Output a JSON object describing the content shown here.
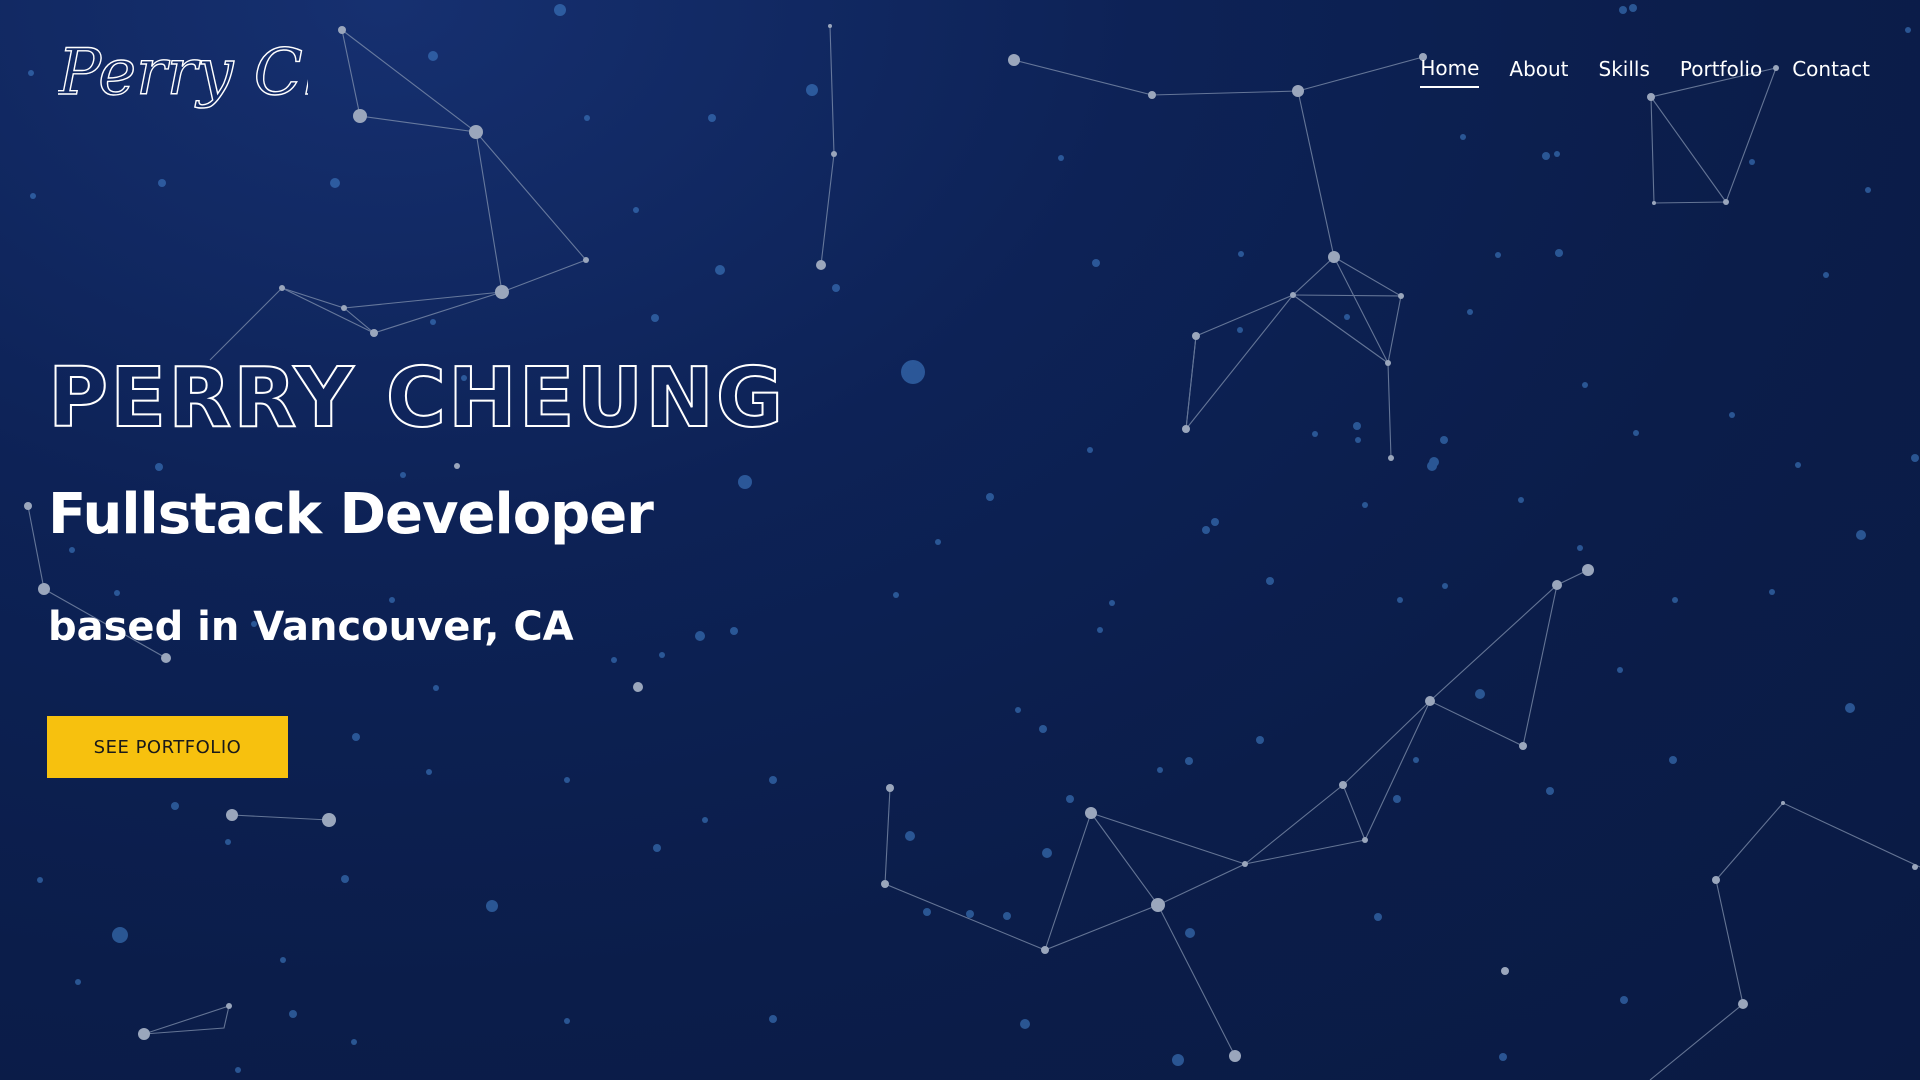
{
  "brand": {
    "logo_text": "Perry Cheung"
  },
  "nav": {
    "items": [
      {
        "label": "Home",
        "active": true
      },
      {
        "label": "About",
        "active": false
      },
      {
        "label": "Skills",
        "active": false
      },
      {
        "label": "Portfolio",
        "active": false
      },
      {
        "label": "Contact",
        "active": false
      }
    ]
  },
  "hero": {
    "name": "PERRY CHEUNG",
    "title": "Fullstack Developer",
    "subtitle": "based in Vancouver, CA",
    "cta_label": "SEE PORTFOLIO"
  },
  "colors": {
    "background": "#0b1d4a",
    "accent": "#f7c10e",
    "text": "#ffffff",
    "particle": "#8a9ab5"
  }
}
